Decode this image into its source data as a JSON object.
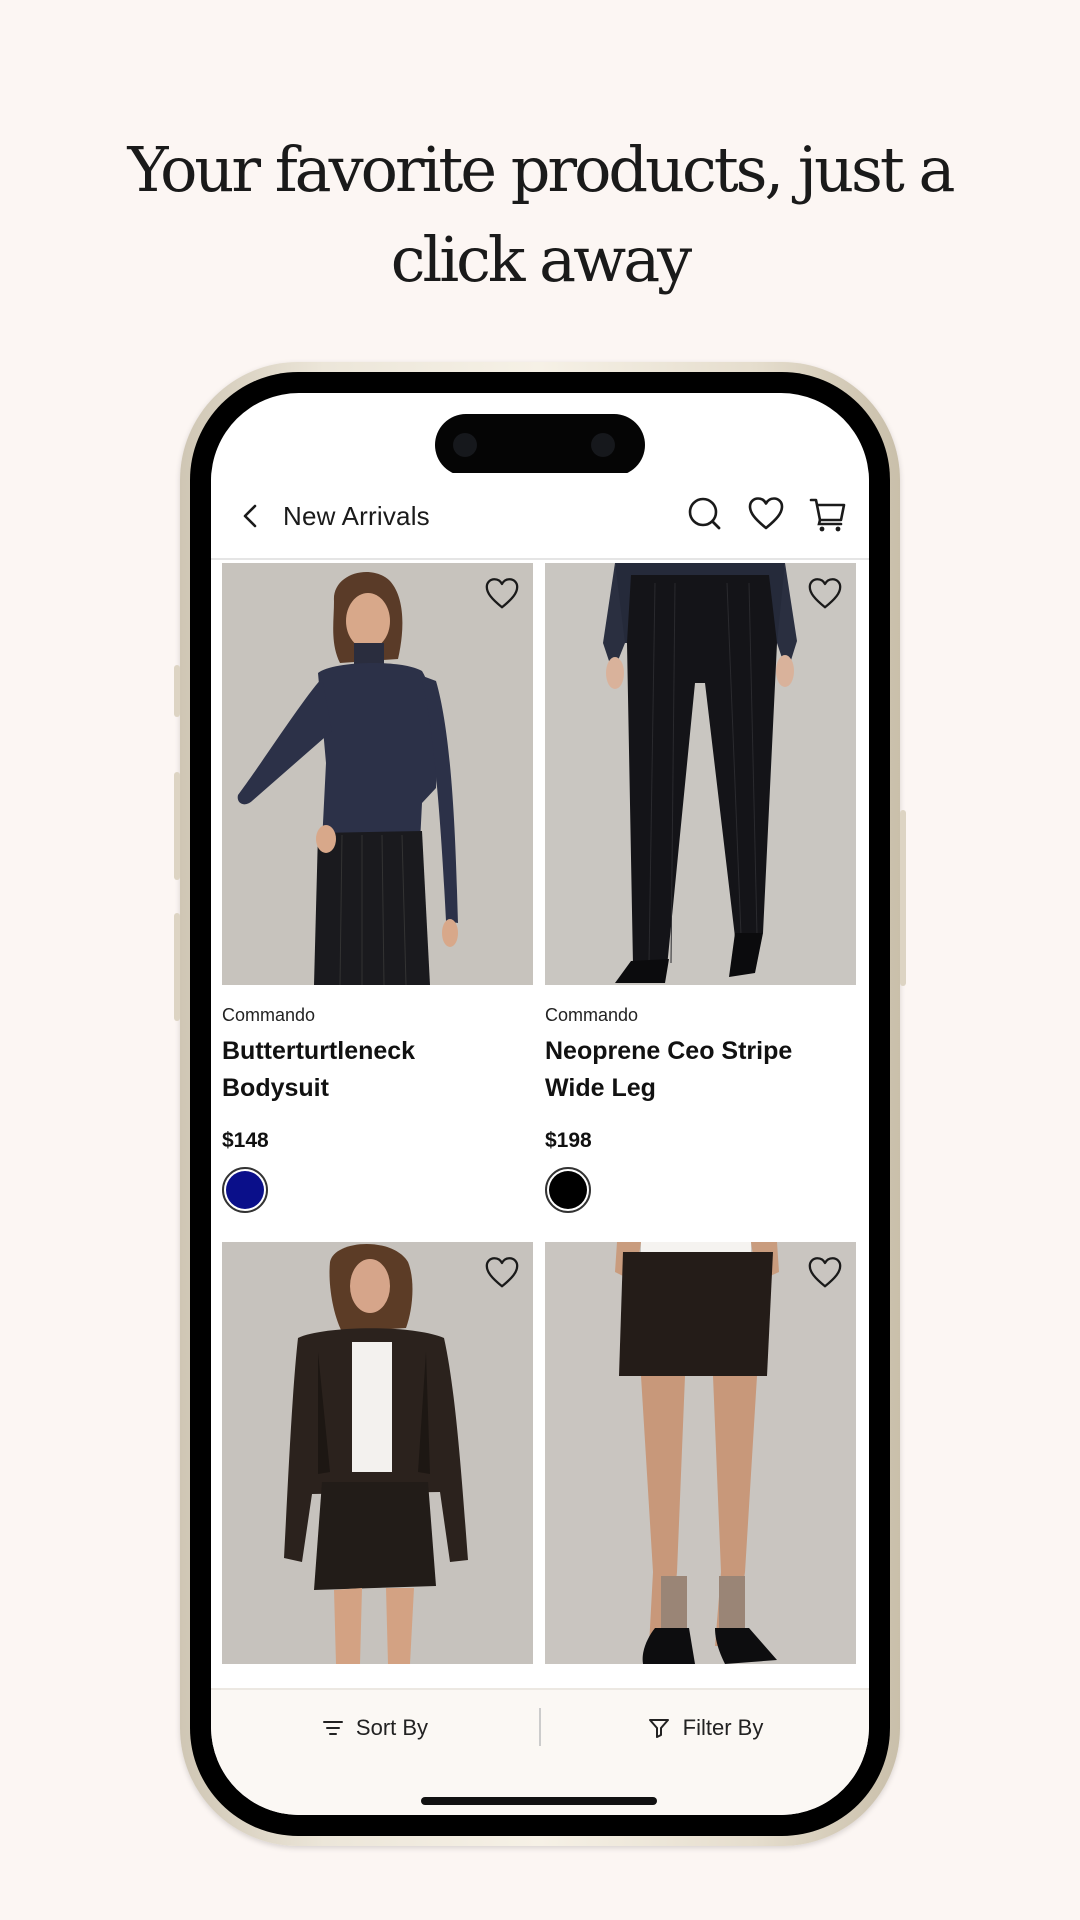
{
  "headline": {
    "line1": "Your favorite products, just a",
    "line2": "click away"
  },
  "header": {
    "title": "New Arrivals",
    "icons": [
      "back-chevron-icon",
      "search-icon",
      "heart-icon",
      "cart-icon"
    ]
  },
  "products": [
    {
      "brand": "Commando",
      "name": "Butterturtleneck Bodysuit",
      "price": "$148",
      "swatch_color": "#0a0f8a"
    },
    {
      "brand": "Commando",
      "name": "Neoprene Ceo Stripe Wide Leg",
      "price": "$198",
      "swatch_color": "#000000"
    },
    {
      "brand": "",
      "name": "",
      "price": ""
    },
    {
      "brand": "",
      "name": "",
      "price": ""
    }
  ],
  "bottom_bar": {
    "sort_label": "Sort By",
    "filter_label": "Filter By"
  },
  "colors": {
    "background": "#fcf6f3",
    "phone_frame": "#ece6d9",
    "photo_bg": "#c8c4bf"
  }
}
